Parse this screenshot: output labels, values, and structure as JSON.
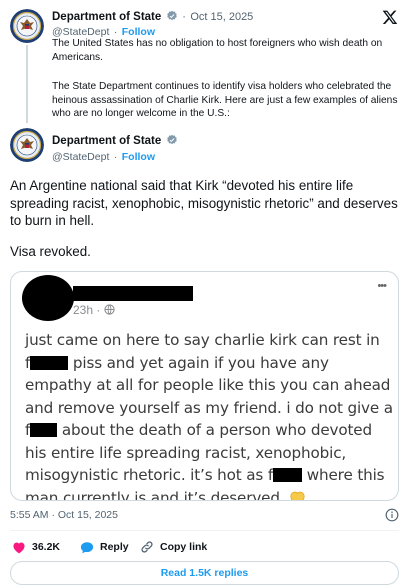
{
  "platform": {
    "logo": "x-logo-icon"
  },
  "parent_tweet": {
    "author_name": "Department of State",
    "date": "Oct 15, 2025",
    "handle": "@StateDept",
    "follow_label": "Follow",
    "paragraph1": "The United States has no obligation to host foreigners who wish death on Americans.",
    "paragraph2": "The State Department continues to identify visa holders who celebrated the heinous assassination of Charlie Kirk. Here are just a few examples of aliens who are no longer welcome in the U.S.:"
  },
  "main_tweet": {
    "author_name": "Department of State",
    "handle": "@StateDept",
    "follow_label": "Follow",
    "paragraph1": "An Argentine national said that Kirk “devoted his entire life spreading racist, xenophobic, misogynistic rhetoric” and deserves to burn in hell.",
    "paragraph2": "Visa revoked.",
    "timestamp": "5:55 AM · Oct 15, 2025",
    "likes": "36.2K",
    "reply_label": "Reply",
    "copy_link_label": "Copy link",
    "read_replies_label": "Read 1.5K replies"
  },
  "embedded_post": {
    "time": "23h",
    "more_menu": "•••",
    "line1": "just came on here to say charlie kirk can rest in",
    "line2a": "f",
    "line2b": " piss and yet again if you have any",
    "line3": "empathy at all for people like this you can ahead",
    "line4": "and remove yourself as my friend. i do not give a",
    "line5a": "f",
    "line5b": " about the death of a person who devoted",
    "line6": "his entire life spreading racist, xenophobic,",
    "line7a": "misogynistic rhetoric. it’s hot as f",
    "line7b": " where this",
    "line8": "man currently is and it’s deserved"
  },
  "colors": {
    "accent": "#1d9bf0",
    "like": "#f91880",
    "text": "#0f1419",
    "muted": "#536471",
    "verified": "#829aab"
  }
}
